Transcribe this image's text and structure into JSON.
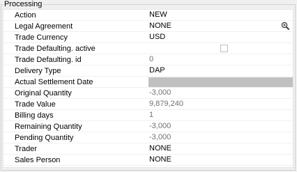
{
  "group": {
    "title": "Processing"
  },
  "rows": [
    {
      "label": "Action",
      "value": "NEW"
    },
    {
      "label": "Legal Agreement",
      "value": "NONE",
      "icon": "magnifier-icon"
    },
    {
      "label": "Trade Currency",
      "value": "USD"
    },
    {
      "label": "Trade Defaulting. active",
      "checked": false
    },
    {
      "label": "Trade Defaulting. id",
      "value": "0"
    },
    {
      "label": "Delivery Type",
      "value": "DAP"
    },
    {
      "label": "Actual Settlement Date",
      "value": ""
    },
    {
      "label": "Original Quantity",
      "value": "-3,000"
    },
    {
      "label": "Trade Value",
      "value": "9,879,240"
    },
    {
      "label": "Billing days",
      "value": "1"
    },
    {
      "label": "Remaining Quantity",
      "value": "-3,000"
    },
    {
      "label": "Pending Quantity",
      "value": "-3,000"
    },
    {
      "label": "Trader",
      "value": "NONE"
    },
    {
      "label": "Sales Person",
      "value": "NONE"
    }
  ]
}
